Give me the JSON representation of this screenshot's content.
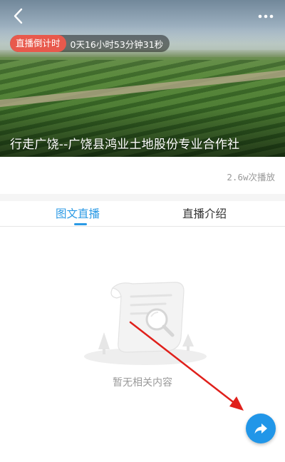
{
  "header": {
    "countdown_tag": "直播倒计时",
    "countdown_time": "0天16小时53分钟31秒",
    "title": "行走广饶--广饶县鸿业土地股份专业合作社"
  },
  "stats": {
    "views": "2.6w次播放"
  },
  "tabs": [
    {
      "label": "图文直播",
      "active": true
    },
    {
      "label": "直播介绍",
      "active": false
    }
  ],
  "empty_state": {
    "message": "暂无相关内容"
  },
  "colors": {
    "accent": "#2b9ae5",
    "countdown_tag": "#e8594c",
    "annotation_arrow": "#e0201b"
  },
  "icons": {
    "back": "back-arrow-icon",
    "more": "more-dots-icon",
    "share": "share-arrow-icon",
    "empty": "empty-document-search-icon"
  }
}
